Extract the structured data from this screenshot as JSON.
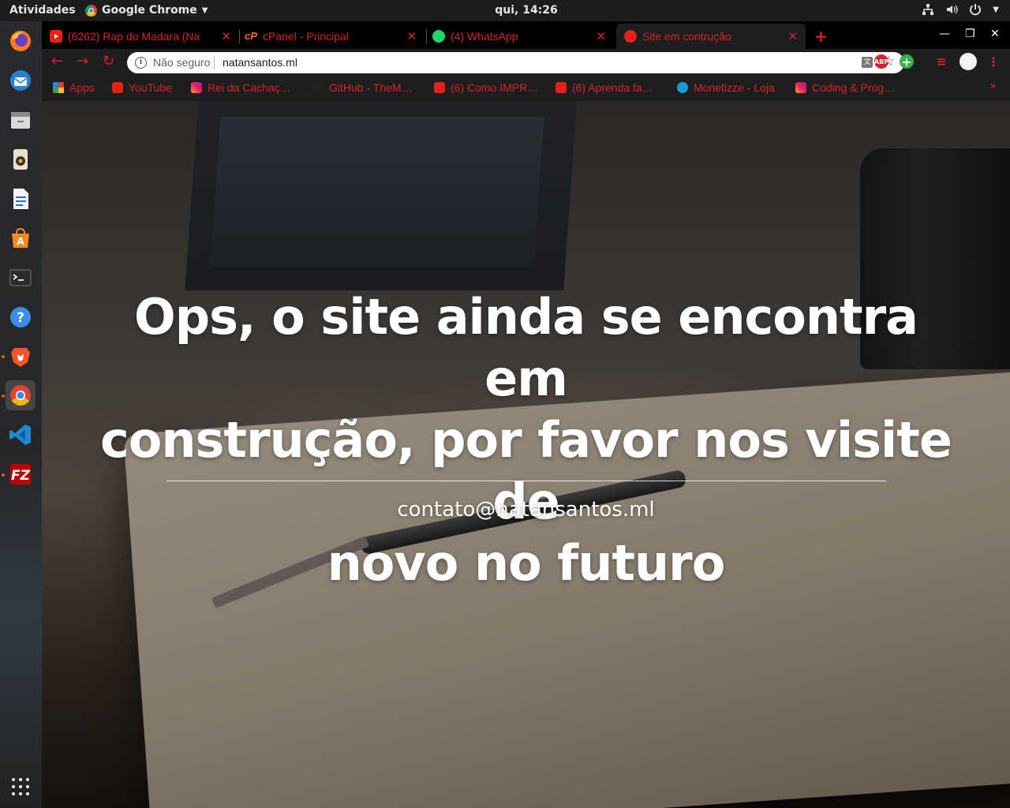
{
  "topbar": {
    "activities": "Atividades",
    "app_name": "Google Chrome",
    "clock": "qui, 14:26"
  },
  "dock": {
    "items": [
      "firefox-icon",
      "thunderbird-icon",
      "files-icon",
      "rhythmbox-icon",
      "libreoffice-writer-icon",
      "software-center-icon",
      "terminal-icon",
      "help-icon",
      "brave-icon",
      "chrome-icon",
      "vscode-icon",
      "filezilla-icon"
    ]
  },
  "tabs": [
    {
      "label": "(6262) Rap do Madara (Na",
      "icon": "youtube-icon",
      "color": "#e62117"
    },
    {
      "label": "cPanel - Principal",
      "icon": "cpanel-icon",
      "color": "#ff6c2c"
    },
    {
      "label": "(4) WhatsApp",
      "icon": "whatsapp-icon",
      "color": "#25d366"
    },
    {
      "label": "Site em contrução",
      "icon": "site-icon",
      "color": "#e62117"
    }
  ],
  "toolbar": {
    "security_text": "Não seguro",
    "url": "natansantos.ml",
    "abp_label": "ABP"
  },
  "bookmarks": [
    {
      "label": "Apps",
      "icon": "apps-grid-icon"
    },
    {
      "label": "YouTube",
      "icon": "youtube-icon"
    },
    {
      "label": "Rei da Cachaç…",
      "icon": "instagram-icon"
    },
    {
      "label": "GitHub - TheM…",
      "icon": "github-icon"
    },
    {
      "label": "(6) Como IMPR…",
      "icon": "youtube-icon"
    },
    {
      "label": "(6) Aprenda fa…",
      "icon": "youtube-icon"
    },
    {
      "label": "Monetizze - Loja",
      "icon": "monetizze-icon"
    },
    {
      "label": "Coding & Prog…",
      "icon": "instagram-icon"
    }
  ],
  "bookmarks_more": "»",
  "page": {
    "headline_line1": "Ops, o site ainda se encontra em",
    "headline_line2": "construção, por favor nos visite de",
    "headline_line3": "novo no futuro",
    "contact": "contato@natansantos.ml"
  }
}
